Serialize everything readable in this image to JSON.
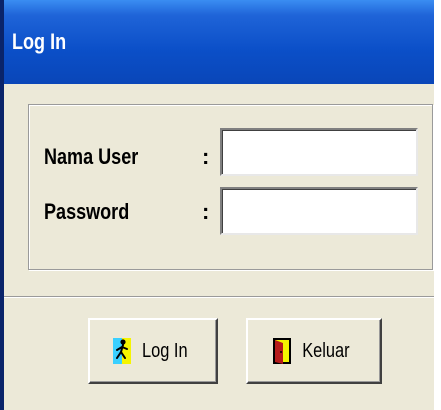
{
  "window": {
    "title": "Log In"
  },
  "form": {
    "username_label": "Nama User",
    "username_colon": ":",
    "username_value": "",
    "password_label": "Password",
    "password_colon": ":",
    "password_value": ""
  },
  "buttons": {
    "login_label": "Log In",
    "login_icon": "walking-man-icon",
    "exit_label": "Keluar",
    "exit_icon": "exit-door-icon"
  },
  "colors": {
    "title_bar": "#0b4fc8",
    "window_bg": "#ece9d8",
    "login_icon_bg": "#f5f500",
    "exit_icon_bg": "#f5f500"
  }
}
